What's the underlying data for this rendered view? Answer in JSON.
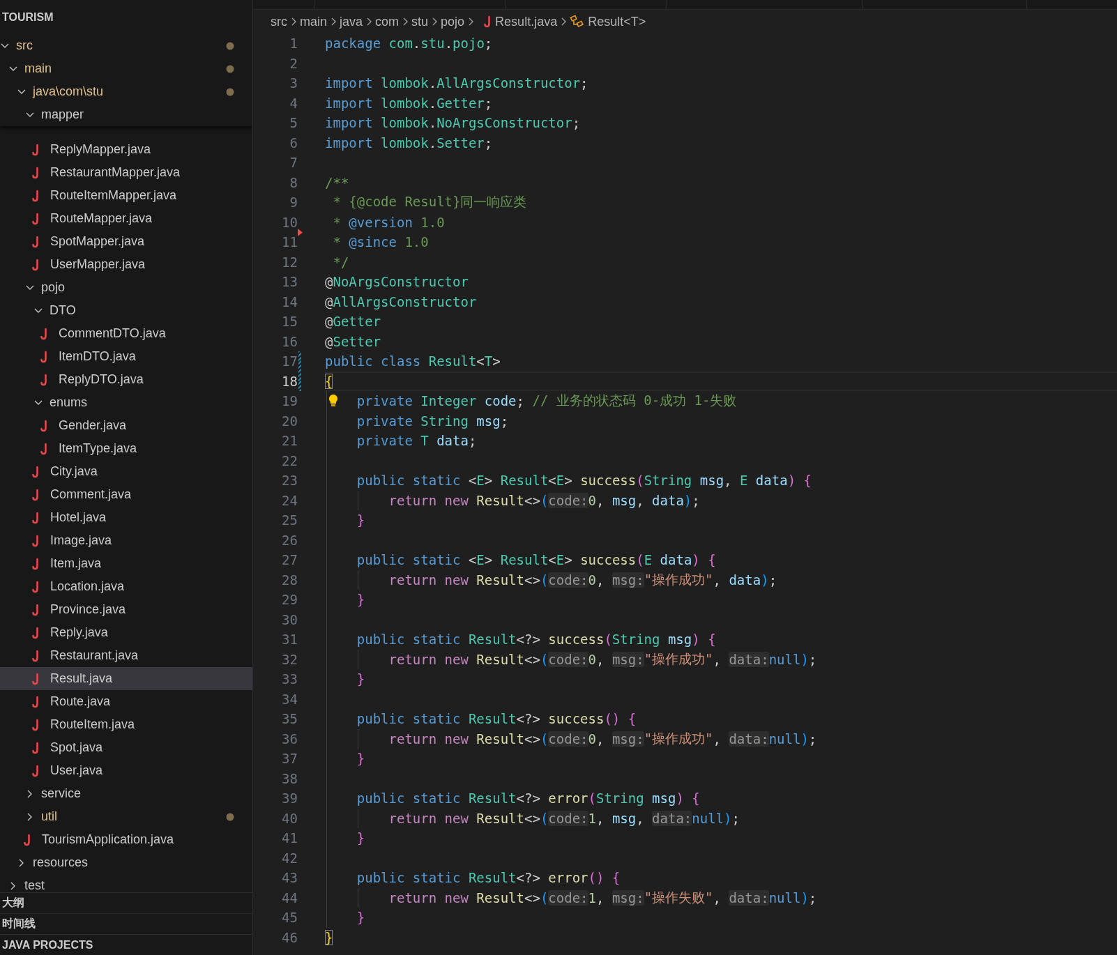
{
  "explorer": {
    "title": "TOURISM",
    "tree": [
      {
        "label": "src",
        "kind": "folder",
        "expanded": true,
        "modified": true,
        "selected": false,
        "children": [
          {
            "label": "main",
            "kind": "folder",
            "expanded": true,
            "modified": true,
            "selected": false,
            "children": [
              {
                "label": "java\\com\\stu",
                "kind": "folder",
                "expanded": true,
                "modified": true,
                "selected": false,
                "children": [
                  {
                    "label": "mapper",
                    "kind": "folder",
                    "expanded": true,
                    "modified": false,
                    "selected": false,
                    "children": [
                      {
                        "label": "ReplyMapper.java",
                        "kind": "file",
                        "modified": false,
                        "selected": false
                      },
                      {
                        "label": "RestaurantMapper.java",
                        "kind": "file",
                        "modified": false,
                        "selected": false
                      },
                      {
                        "label": "RouteItemMapper.java",
                        "kind": "file",
                        "modified": false,
                        "selected": false
                      },
                      {
                        "label": "RouteMapper.java",
                        "kind": "file",
                        "modified": false,
                        "selected": false
                      },
                      {
                        "label": "SpotMapper.java",
                        "kind": "file",
                        "modified": false,
                        "selected": false
                      },
                      {
                        "label": "UserMapper.java",
                        "kind": "file",
                        "modified": false,
                        "selected": false
                      }
                    ]
                  },
                  {
                    "label": "pojo",
                    "kind": "folder",
                    "expanded": true,
                    "modified": false,
                    "selected": false,
                    "children": [
                      {
                        "label": "DTO",
                        "kind": "folder",
                        "expanded": true,
                        "modified": false,
                        "selected": false,
                        "children": [
                          {
                            "label": "CommentDTO.java",
                            "kind": "file",
                            "modified": false,
                            "selected": false
                          },
                          {
                            "label": "ItemDTO.java",
                            "kind": "file",
                            "modified": false,
                            "selected": false
                          },
                          {
                            "label": "ReplyDTO.java",
                            "kind": "file",
                            "modified": false,
                            "selected": false
                          }
                        ]
                      },
                      {
                        "label": "enums",
                        "kind": "folder",
                        "expanded": true,
                        "modified": false,
                        "selected": false,
                        "children": [
                          {
                            "label": "Gender.java",
                            "kind": "file",
                            "modified": false,
                            "selected": false
                          },
                          {
                            "label": "ItemType.java",
                            "kind": "file",
                            "modified": false,
                            "selected": false
                          }
                        ]
                      },
                      {
                        "label": "City.java",
                        "kind": "file",
                        "modified": false,
                        "selected": false
                      },
                      {
                        "label": "Comment.java",
                        "kind": "file",
                        "modified": false,
                        "selected": false
                      },
                      {
                        "label": "Hotel.java",
                        "kind": "file",
                        "modified": false,
                        "selected": false
                      },
                      {
                        "label": "Image.java",
                        "kind": "file",
                        "modified": false,
                        "selected": false
                      },
                      {
                        "label": "Item.java",
                        "kind": "file",
                        "modified": false,
                        "selected": false
                      },
                      {
                        "label": "Location.java",
                        "kind": "file",
                        "modified": false,
                        "selected": false
                      },
                      {
                        "label": "Province.java",
                        "kind": "file",
                        "modified": false,
                        "selected": false
                      },
                      {
                        "label": "Reply.java",
                        "kind": "file",
                        "modified": false,
                        "selected": false
                      },
                      {
                        "label": "Restaurant.java",
                        "kind": "file",
                        "modified": false,
                        "selected": false
                      },
                      {
                        "label": "Result.java",
                        "kind": "file",
                        "modified": false,
                        "selected": true
                      },
                      {
                        "label": "Route.java",
                        "kind": "file",
                        "modified": false,
                        "selected": false
                      },
                      {
                        "label": "RouteItem.java",
                        "kind": "file",
                        "modified": false,
                        "selected": false
                      },
                      {
                        "label": "Spot.java",
                        "kind": "file",
                        "modified": false,
                        "selected": false
                      },
                      {
                        "label": "User.java",
                        "kind": "file",
                        "modified": false,
                        "selected": false
                      }
                    ]
                  },
                  {
                    "label": "service",
                    "kind": "folder",
                    "expanded": false,
                    "modified": false,
                    "selected": false
                  },
                  {
                    "label": "util",
                    "kind": "folder",
                    "expanded": false,
                    "modified": true,
                    "selected": false
                  },
                  {
                    "label": "TourismApplication.java",
                    "kind": "file",
                    "modified": false,
                    "selected": false
                  }
                ]
              },
              {
                "label": "resources",
                "kind": "folder",
                "expanded": false,
                "modified": false,
                "selected": false
              }
            ]
          },
          {
            "label": "test",
            "kind": "folder",
            "expanded": false,
            "modified": false,
            "selected": false
          }
        ]
      }
    ]
  },
  "panels": [
    {
      "title": "大纲"
    },
    {
      "title": "时间线"
    },
    {
      "title": "JAVA PROJECTS"
    }
  ],
  "editor": {
    "breadcrumb": [
      {
        "label": "src",
        "kind": "folder"
      },
      {
        "label": "main",
        "kind": "folder"
      },
      {
        "label": "java",
        "kind": "folder"
      },
      {
        "label": "com",
        "kind": "folder"
      },
      {
        "label": "stu",
        "kind": "folder"
      },
      {
        "label": "pojo",
        "kind": "folder"
      },
      {
        "label": "Result.java",
        "kind": "file"
      },
      {
        "label": "Result<T>",
        "kind": "symbol"
      }
    ],
    "lines": [
      {
        "number": "1",
        "tokens": [
          {
            "kind": "kw",
            "text": "package "
          },
          {
            "kind": "ty",
            "text": "com"
          },
          {
            "kind": "p",
            "text": "."
          },
          {
            "kind": "ty",
            "text": "stu"
          },
          {
            "kind": "p",
            "text": "."
          },
          {
            "kind": "ty",
            "text": "pojo"
          },
          {
            "kind": "p",
            "text": ";"
          }
        ]
      },
      {
        "number": "2"
      },
      {
        "number": "3",
        "tokens": [
          {
            "kind": "kw",
            "text": "import "
          },
          {
            "kind": "ty",
            "text": "lombok"
          },
          {
            "kind": "p",
            "text": "."
          },
          {
            "kind": "ty",
            "text": "AllArgsConstructor"
          },
          {
            "kind": "p",
            "text": ";"
          }
        ]
      },
      {
        "number": "4",
        "tokens": [
          {
            "kind": "kw",
            "text": "import "
          },
          {
            "kind": "ty",
            "text": "lombok"
          },
          {
            "kind": "p",
            "text": "."
          },
          {
            "kind": "ty",
            "text": "Getter"
          },
          {
            "kind": "p",
            "text": ";"
          }
        ]
      },
      {
        "number": "5",
        "tokens": [
          {
            "kind": "kw",
            "text": "import "
          },
          {
            "kind": "ty",
            "text": "lombok"
          },
          {
            "kind": "p",
            "text": "."
          },
          {
            "kind": "ty",
            "text": "NoArgsConstructor"
          },
          {
            "kind": "p",
            "text": ";"
          }
        ]
      },
      {
        "number": "6",
        "tokens": [
          {
            "kind": "kw",
            "text": "import "
          },
          {
            "kind": "ty",
            "text": "lombok"
          },
          {
            "kind": "p",
            "text": "."
          },
          {
            "kind": "ty",
            "text": "Setter"
          },
          {
            "kind": "p",
            "text": ";"
          }
        ]
      },
      {
        "number": "7"
      },
      {
        "number": "8",
        "tokens": [
          {
            "kind": "cm",
            "text": "/**"
          }
        ]
      },
      {
        "number": "9",
        "tokens": [
          {
            "kind": "cm",
            "text": " * {@code Result}同一响应类"
          }
        ]
      },
      {
        "number": "10",
        "deleted_below": true,
        "tokens": [
          {
            "kind": "cm",
            "text": " * "
          },
          {
            "kind": "doc",
            "text": "@version"
          },
          {
            "kind": "cm",
            "text": " 1.0"
          }
        ]
      },
      {
        "number": "11",
        "tokens": [
          {
            "kind": "cm",
            "text": " * "
          },
          {
            "kind": "doc",
            "text": "@since"
          },
          {
            "kind": "cm",
            "text": " 1.0"
          }
        ]
      },
      {
        "number": "12",
        "tokens": [
          {
            "kind": "cm",
            "text": " */"
          }
        ]
      },
      {
        "number": "13",
        "tokens": [
          {
            "kind": "p",
            "text": "@"
          },
          {
            "kind": "ty",
            "text": "NoArgsConstructor"
          }
        ]
      },
      {
        "number": "14",
        "tokens": [
          {
            "kind": "p",
            "text": "@"
          },
          {
            "kind": "ty",
            "text": "AllArgsConstructor"
          }
        ]
      },
      {
        "number": "15",
        "tokens": [
          {
            "kind": "p",
            "text": "@"
          },
          {
            "kind": "ty",
            "text": "Getter"
          }
        ]
      },
      {
        "number": "16",
        "tokens": [
          {
            "kind": "p",
            "text": "@"
          },
          {
            "kind": "ty",
            "text": "Setter"
          }
        ]
      },
      {
        "number": "17",
        "modified": true,
        "tokens": [
          {
            "kind": "kw",
            "text": "public class "
          },
          {
            "kind": "ty",
            "text": "Result"
          },
          {
            "kind": "p",
            "text": "<"
          },
          {
            "kind": "ty",
            "text": "T"
          },
          {
            "kind": "p",
            "text": ">"
          }
        ]
      },
      {
        "number": "18",
        "modified": true,
        "current": true,
        "tokens": [
          {
            "kind": "brace-match",
            "text": "{"
          }
        ]
      },
      {
        "number": "19",
        "lightbulb": true,
        "tokens": [
          {
            "kind": "kw",
            "text": "    private "
          },
          {
            "kind": "ty",
            "text": "Integer "
          },
          {
            "kind": "var",
            "text": "code"
          },
          {
            "kind": "p",
            "text": "; "
          },
          {
            "kind": "cm",
            "text": "// 业务的状态码 0-成功 1-失败"
          }
        ]
      },
      {
        "number": "20",
        "tokens": [
          {
            "kind": "kw",
            "text": "    private "
          },
          {
            "kind": "ty",
            "text": "String "
          },
          {
            "kind": "var",
            "text": "msg"
          },
          {
            "kind": "p",
            "text": ";"
          }
        ]
      },
      {
        "number": "21",
        "tokens": [
          {
            "kind": "kw",
            "text": "    private "
          },
          {
            "kind": "ty",
            "text": "T "
          },
          {
            "kind": "var",
            "text": "data"
          },
          {
            "kind": "p",
            "text": ";"
          }
        ]
      },
      {
        "number": "22"
      },
      {
        "number": "23",
        "tokens": [
          {
            "kind": "kw",
            "text": "    public static "
          },
          {
            "kind": "p",
            "text": "<"
          },
          {
            "kind": "ty",
            "text": "E"
          },
          {
            "kind": "p",
            "text": "> "
          },
          {
            "kind": "ty",
            "text": "Result"
          },
          {
            "kind": "p",
            "text": "<"
          },
          {
            "kind": "ty",
            "text": "E"
          },
          {
            "kind": "p",
            "text": "> "
          },
          {
            "kind": "fn",
            "text": "success"
          },
          {
            "kind": "brace2",
            "text": "("
          },
          {
            "kind": "ty",
            "text": "String "
          },
          {
            "kind": "var",
            "text": "msg"
          },
          {
            "kind": "p",
            "text": ", "
          },
          {
            "kind": "ty",
            "text": "E "
          },
          {
            "kind": "var",
            "text": "data"
          },
          {
            "kind": "brace2",
            "text": ")"
          },
          {
            "kind": "brace2",
            "text": " {"
          }
        ]
      },
      {
        "number": "24",
        "tokens": [
          {
            "kind": "ctl",
            "text": "        return new "
          },
          {
            "kind": "fn",
            "text": "Result"
          },
          {
            "kind": "p",
            "text": "<>"
          },
          {
            "kind": "brace3",
            "text": "("
          },
          {
            "kind": "hint",
            "text": "code:"
          },
          {
            "kind": "num",
            "text": "0"
          },
          {
            "kind": "p",
            "text": ", "
          },
          {
            "kind": "var",
            "text": "msg"
          },
          {
            "kind": "p",
            "text": ", "
          },
          {
            "kind": "var",
            "text": "data"
          },
          {
            "kind": "brace3",
            "text": ")"
          },
          {
            "kind": "p",
            "text": ";"
          }
        ]
      },
      {
        "number": "25",
        "tokens": [
          {
            "kind": "brace2",
            "text": "    }"
          }
        ]
      },
      {
        "number": "26"
      },
      {
        "number": "27",
        "tokens": [
          {
            "kind": "kw",
            "text": "    public static "
          },
          {
            "kind": "p",
            "text": "<"
          },
          {
            "kind": "ty",
            "text": "E"
          },
          {
            "kind": "p",
            "text": "> "
          },
          {
            "kind": "ty",
            "text": "Result"
          },
          {
            "kind": "p",
            "text": "<"
          },
          {
            "kind": "ty",
            "text": "E"
          },
          {
            "kind": "p",
            "text": "> "
          },
          {
            "kind": "fn",
            "text": "success"
          },
          {
            "kind": "brace2",
            "text": "("
          },
          {
            "kind": "ty",
            "text": "E "
          },
          {
            "kind": "var",
            "text": "data"
          },
          {
            "kind": "brace2",
            "text": ")"
          },
          {
            "kind": "brace2",
            "text": " {"
          }
        ]
      },
      {
        "number": "28",
        "tokens": [
          {
            "kind": "ctl",
            "text": "        return new "
          },
          {
            "kind": "fn",
            "text": "Result"
          },
          {
            "kind": "p",
            "text": "<>"
          },
          {
            "kind": "brace3",
            "text": "("
          },
          {
            "kind": "hint",
            "text": "code:"
          },
          {
            "kind": "num",
            "text": "0"
          },
          {
            "kind": "p",
            "text": ", "
          },
          {
            "kind": "hint",
            "text": "msg:"
          },
          {
            "kind": "str",
            "text": "\"操作成功\""
          },
          {
            "kind": "p",
            "text": ", "
          },
          {
            "kind": "var",
            "text": "data"
          },
          {
            "kind": "brace3",
            "text": ")"
          },
          {
            "kind": "p",
            "text": ";"
          }
        ]
      },
      {
        "number": "29",
        "tokens": [
          {
            "kind": "brace2",
            "text": "    }"
          }
        ]
      },
      {
        "number": "30"
      },
      {
        "number": "31",
        "tokens": [
          {
            "kind": "kw",
            "text": "    public static "
          },
          {
            "kind": "ty",
            "text": "Result"
          },
          {
            "kind": "p",
            "text": "<?> "
          },
          {
            "kind": "fn",
            "text": "success"
          },
          {
            "kind": "brace2",
            "text": "("
          },
          {
            "kind": "ty",
            "text": "String "
          },
          {
            "kind": "var",
            "text": "msg"
          },
          {
            "kind": "brace2",
            "text": ")"
          },
          {
            "kind": "brace2",
            "text": " {"
          }
        ]
      },
      {
        "number": "32",
        "tokens": [
          {
            "kind": "ctl",
            "text": "        return new "
          },
          {
            "kind": "fn",
            "text": "Result"
          },
          {
            "kind": "p",
            "text": "<>"
          },
          {
            "kind": "brace3",
            "text": "("
          },
          {
            "kind": "hint",
            "text": "code:"
          },
          {
            "kind": "num",
            "text": "0"
          },
          {
            "kind": "p",
            "text": ", "
          },
          {
            "kind": "hint",
            "text": "msg:"
          },
          {
            "kind": "str",
            "text": "\"操作成功\""
          },
          {
            "kind": "p",
            "text": ", "
          },
          {
            "kind": "hint",
            "text": "data:"
          },
          {
            "kind": "kw",
            "text": "null"
          },
          {
            "kind": "brace3",
            "text": ")"
          },
          {
            "kind": "p",
            "text": ";"
          }
        ]
      },
      {
        "number": "33",
        "tokens": [
          {
            "kind": "brace2",
            "text": "    }"
          }
        ]
      },
      {
        "number": "34"
      },
      {
        "number": "35",
        "tokens": [
          {
            "kind": "kw",
            "text": "    public static "
          },
          {
            "kind": "ty",
            "text": "Result"
          },
          {
            "kind": "p",
            "text": "<?> "
          },
          {
            "kind": "fn",
            "text": "success"
          },
          {
            "kind": "brace2",
            "text": "()"
          },
          {
            "kind": "brace2",
            "text": " {"
          }
        ]
      },
      {
        "number": "36",
        "tokens": [
          {
            "kind": "ctl",
            "text": "        return new "
          },
          {
            "kind": "fn",
            "text": "Result"
          },
          {
            "kind": "p",
            "text": "<>"
          },
          {
            "kind": "brace3",
            "text": "("
          },
          {
            "kind": "hint",
            "text": "code:"
          },
          {
            "kind": "num",
            "text": "0"
          },
          {
            "kind": "p",
            "text": ", "
          },
          {
            "kind": "hint",
            "text": "msg:"
          },
          {
            "kind": "str",
            "text": "\"操作成功\""
          },
          {
            "kind": "p",
            "text": ", "
          },
          {
            "kind": "hint",
            "text": "data:"
          },
          {
            "kind": "kw",
            "text": "null"
          },
          {
            "kind": "brace3",
            "text": ")"
          },
          {
            "kind": "p",
            "text": ";"
          }
        ]
      },
      {
        "number": "37",
        "tokens": [
          {
            "kind": "brace2",
            "text": "    }"
          }
        ]
      },
      {
        "number": "38"
      },
      {
        "number": "39",
        "tokens": [
          {
            "kind": "kw",
            "text": "    public static "
          },
          {
            "kind": "ty",
            "text": "Result"
          },
          {
            "kind": "p",
            "text": "<?> "
          },
          {
            "kind": "fn",
            "text": "error"
          },
          {
            "kind": "brace2",
            "text": "("
          },
          {
            "kind": "ty",
            "text": "String "
          },
          {
            "kind": "var",
            "text": "msg"
          },
          {
            "kind": "brace2",
            "text": ")"
          },
          {
            "kind": "brace2",
            "text": " {"
          }
        ]
      },
      {
        "number": "40",
        "tokens": [
          {
            "kind": "ctl",
            "text": "        return new "
          },
          {
            "kind": "fn",
            "text": "Result"
          },
          {
            "kind": "p",
            "text": "<>"
          },
          {
            "kind": "brace3",
            "text": "("
          },
          {
            "kind": "hint",
            "text": "code:"
          },
          {
            "kind": "num",
            "text": "1"
          },
          {
            "kind": "p",
            "text": ", "
          },
          {
            "kind": "var",
            "text": "msg"
          },
          {
            "kind": "p",
            "text": ", "
          },
          {
            "kind": "hint",
            "text": "data:"
          },
          {
            "kind": "kw",
            "text": "null"
          },
          {
            "kind": "brace3",
            "text": ")"
          },
          {
            "kind": "p",
            "text": ";"
          }
        ]
      },
      {
        "number": "41",
        "tokens": [
          {
            "kind": "brace2",
            "text": "    }"
          }
        ]
      },
      {
        "number": "42"
      },
      {
        "number": "43",
        "tokens": [
          {
            "kind": "kw",
            "text": "    public static "
          },
          {
            "kind": "ty",
            "text": "Result"
          },
          {
            "kind": "p",
            "text": "<?> "
          },
          {
            "kind": "fn",
            "text": "error"
          },
          {
            "kind": "brace2",
            "text": "()"
          },
          {
            "kind": "brace2",
            "text": " {"
          }
        ]
      },
      {
        "number": "44",
        "tokens": [
          {
            "kind": "ctl",
            "text": "        return new "
          },
          {
            "kind": "fn",
            "text": "Result"
          },
          {
            "kind": "p",
            "text": "<>"
          },
          {
            "kind": "brace3",
            "text": "("
          },
          {
            "kind": "hint",
            "text": "code:"
          },
          {
            "kind": "num",
            "text": "1"
          },
          {
            "kind": "p",
            "text": ", "
          },
          {
            "kind": "hint",
            "text": "msg:"
          },
          {
            "kind": "str",
            "text": "\"操作失败\""
          },
          {
            "kind": "p",
            "text": ", "
          },
          {
            "kind": "hint",
            "text": "data:"
          },
          {
            "kind": "kw",
            "text": "null"
          },
          {
            "kind": "brace3",
            "text": ")"
          },
          {
            "kind": "p",
            "text": ";"
          }
        ]
      },
      {
        "number": "45",
        "tokens": [
          {
            "kind": "brace2",
            "text": "    }"
          }
        ]
      },
      {
        "number": "46",
        "tokens": [
          {
            "kind": "brace-match",
            "text": "}"
          }
        ]
      }
    ]
  }
}
